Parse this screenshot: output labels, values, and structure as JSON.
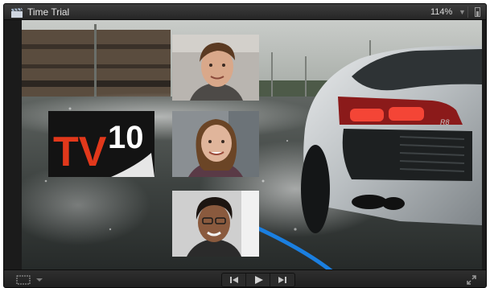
{
  "window": {
    "title": "Time Trial",
    "zoom": "114%"
  },
  "viewer": {
    "logo_text": "TV10",
    "car_badge": "R8"
  },
  "icons": {
    "clapperboard": "clapperboard-icon",
    "zoom_menu": "chevron-down-icon",
    "panel_toggle": "panel-toggle-icon",
    "view_options": "view-options-icon",
    "previous": "skip-back-icon",
    "play": "play-icon",
    "next": "skip-forward-icon",
    "fullscreen": "fullscreen-icon"
  },
  "colors": {
    "title_bar": "#333333",
    "selection_arrow": "#1b7fe0",
    "logo_red": "#e2381b"
  }
}
